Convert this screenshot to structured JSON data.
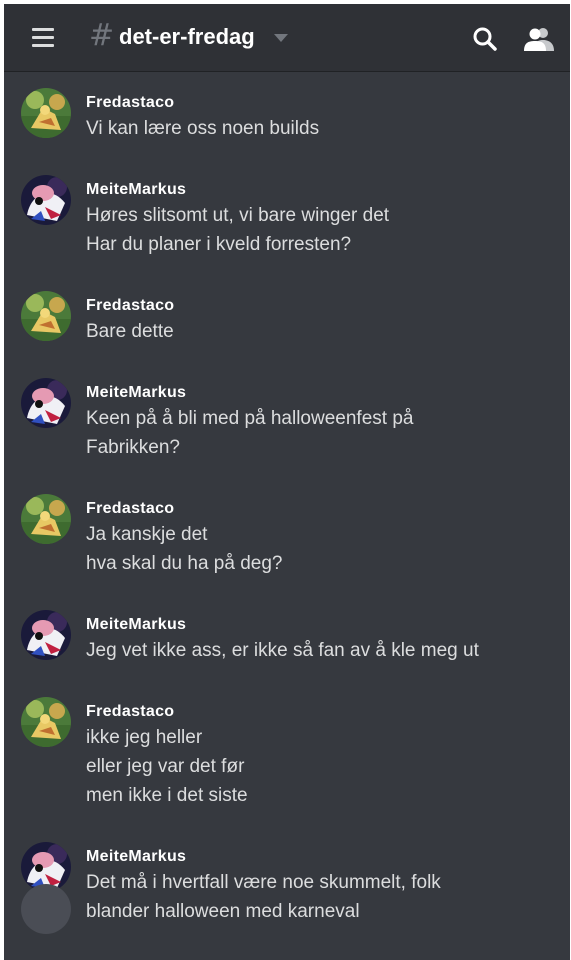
{
  "header": {
    "channel_prefix": "#",
    "channel_name": "det-er-fredag"
  },
  "icons": {
    "menu": "hamburger-menu-icon",
    "search": "search-icon",
    "members": "members-icon"
  },
  "colors": {
    "background": "#36393f",
    "header_bg": "#2f3136",
    "text": "#dcddde",
    "author": "#ffffff"
  },
  "messages": [
    {
      "author": "Fredastaco",
      "lines": [
        "Vi kan lære oss noen builds"
      ]
    },
    {
      "author": "MeiteMarkus",
      "lines": [
        "Høres slitsomt ut, vi bare winger det",
        "Har du planer i kveld forresten?"
      ]
    },
    {
      "author": "Fredastaco",
      "lines": [
        "Bare dette"
      ]
    },
    {
      "author": "MeiteMarkus",
      "lines": [
        "Keen på å bli med på halloweenfest på",
        "Fabrikken?"
      ]
    },
    {
      "author": "Fredastaco",
      "lines": [
        "Ja kanskje det",
        "hva skal du ha på deg?"
      ]
    },
    {
      "author": "MeiteMarkus",
      "lines": [
        "Jeg vet ikke ass, er ikke så fan av å kle meg ut"
      ]
    },
    {
      "author": "Fredastaco",
      "lines": [
        "ikke jeg heller",
        "eller jeg var det før",
        "men ikke i det siste"
      ]
    },
    {
      "author": "MeiteMarkus",
      "lines": [
        "Det må i hvertfall være noe skummelt, folk",
        "blander halloween med karneval"
      ]
    }
  ]
}
